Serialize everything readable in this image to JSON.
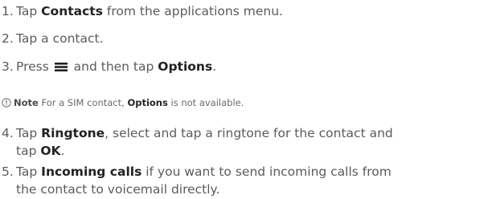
{
  "steps": [
    {
      "number": "1.",
      "parts": [
        "Tap ",
        "Contacts",
        " from the applications menu."
      ]
    },
    {
      "number": "2.",
      "parts": [
        "Tap a contact."
      ]
    },
    {
      "number": "3.",
      "parts": [
        "Press ",
        " and then tap ",
        "Options",
        "."
      ]
    },
    {
      "number": "4.",
      "lines": [
        [
          "Tap ",
          "Ringtone",
          ", select and tap a ringtone for the contact and"
        ],
        [
          "tap ",
          "OK",
          "."
        ]
      ]
    },
    {
      "number": "5.",
      "lines": [
        [
          "Tap ",
          "Incoming calls",
          " if you want to send incoming calls from"
        ],
        [
          "the contact to voicemail directly."
        ]
      ]
    }
  ],
  "note": {
    "label": "Note",
    "parts": [
      " For a SIM contact, ",
      "Options",
      " is not available."
    ]
  },
  "icons": {
    "menu": "menu-icon",
    "note": "note-icon"
  }
}
